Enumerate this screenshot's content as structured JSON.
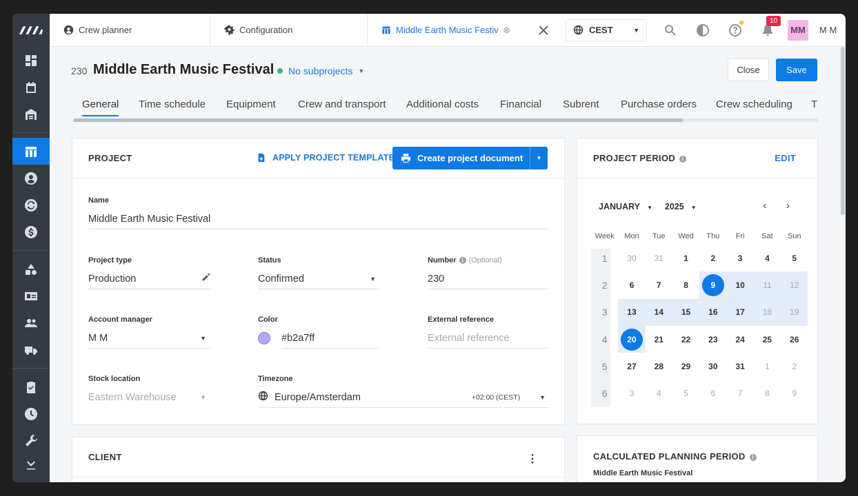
{
  "topbar": {
    "tabs": [
      {
        "label": "Crew planner",
        "icon": "user-circle-icon"
      },
      {
        "label": "Configuration",
        "icon": "gear-icon"
      },
      {
        "label": "Middle Earth Music Festival",
        "icon": "project-icon"
      }
    ],
    "timezone": "CEST",
    "notifications_count": "10",
    "avatar_initials": "MM",
    "user_name": "M M"
  },
  "header": {
    "project_number": "230",
    "project_title": "Middle Earth Music Festival",
    "subprojects_label": "No subprojects",
    "close_label": "Close",
    "save_label": "Save"
  },
  "section_tabs": [
    "General",
    "Time schedule",
    "Equipment",
    "Crew and transport",
    "Additional costs",
    "Financial",
    "Subrent",
    "Purchase orders",
    "Crew scheduling",
    "T"
  ],
  "project_card": {
    "title": "PROJECT",
    "apply_template": "APPLY PROJECT TEMPLATE",
    "create_document": "Create project document",
    "fields": {
      "name_label": "Name",
      "name_value": "Middle Earth Music Festival",
      "project_type_label": "Project type",
      "project_type_value": "Production",
      "status_label": "Status",
      "status_value": "Confirmed",
      "number_label": "Number",
      "number_optional": "(Optional)",
      "number_value": "230",
      "account_manager_label": "Account manager",
      "account_manager_value": "M M",
      "color_label": "Color",
      "color_value": "#b2a7ff",
      "external_ref_label": "External reference",
      "external_ref_placeholder": "External reference",
      "stock_location_label": "Stock location",
      "stock_location_value": "Eastern Warehouse",
      "timezone_label": "Timezone",
      "timezone_value": "Europe/Amsterdam",
      "timezone_offset": "+02:00 (CEST)"
    }
  },
  "client_card": {
    "title": "CLIENT"
  },
  "period_card": {
    "title": "PROJECT PERIOD",
    "edit_label": "EDIT",
    "month": "JANUARY",
    "year": "2025",
    "weekdays": [
      "Week",
      "Mon",
      "Tue",
      "Wed",
      "Thu",
      "Fri",
      "Sat",
      "Sun"
    ],
    "weeks": [
      {
        "week": "1",
        "days": [
          "30",
          "31",
          "1",
          "2",
          "3",
          "4",
          "5"
        ]
      },
      {
        "week": "2",
        "days": [
          "6",
          "7",
          "8",
          "9",
          "10",
          "11",
          "12"
        ]
      },
      {
        "week": "3",
        "days": [
          "13",
          "14",
          "15",
          "16",
          "17",
          "18",
          "19"
        ]
      },
      {
        "week": "4",
        "days": [
          "20",
          "21",
          "22",
          "23",
          "24",
          "25",
          "26"
        ]
      },
      {
        "week": "5",
        "days": [
          "27",
          "28",
          "29",
          "30",
          "31",
          "1",
          "2"
        ]
      },
      {
        "week": "6",
        "days": [
          "3",
          "4",
          "5",
          "6",
          "7",
          "8",
          "9"
        ]
      }
    ],
    "range_start": "9",
    "range_end": "20"
  },
  "calc_card": {
    "title": "CALCULATED PLANNING PERIOD",
    "subtitle": "Middle Earth Music Festival"
  },
  "colors": {
    "accent": "#0e7ae6",
    "sidebar": "#353b40",
    "status_dot": "#2fbf71",
    "project_color": "#b2a7ff"
  }
}
